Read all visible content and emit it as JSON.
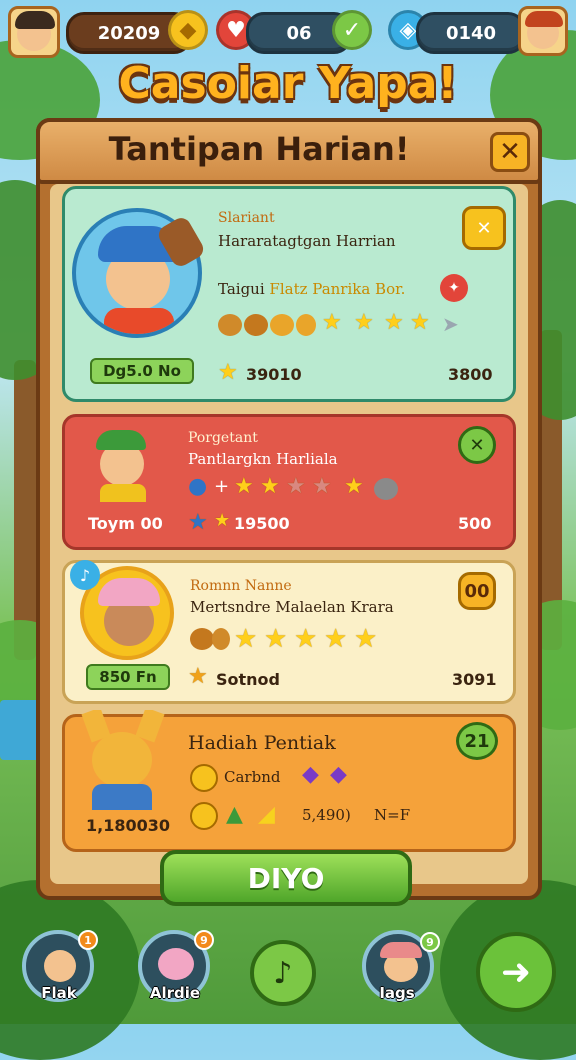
{
  "hud": {
    "coins_value": "20209",
    "hearts_value": "06",
    "gems_value": "0140"
  },
  "title": "Casoiar Yapa!",
  "panel": {
    "title": "Tantipan Harian!",
    "close_icon": "close-icon"
  },
  "cards": [
    {
      "heading": "Slariant",
      "line1": "Hararatagtgan Harrian",
      "line2_prefix": "Taigui",
      "line2_highlight": "Flatz Panrika Bor.",
      "tag": "Dg5.0 No",
      "amount_left": "39010",
      "amount_right": "3800",
      "badge_icon": "close-icon",
      "colors": {
        "bg": "#b9ead0",
        "border": "#2f8a6a"
      }
    },
    {
      "heading": "Porgetant",
      "line1": "Pantlargkn Harliala",
      "label_left": "Toym 00",
      "amount_left": "19500",
      "amount_right": "500",
      "badge_icon": "close-icon",
      "colors": {
        "bg": "#e2584a",
        "border": "#a5362a"
      }
    },
    {
      "heading": "Romnn Nanne",
      "line1": "Mertsndre Malaelan Krara",
      "tag": "850 Fn",
      "label_left": "Sotnod",
      "amount_right": "3091",
      "badge_text": "00",
      "colors": {
        "bg": "#fbf0c8",
        "border": "#c9a356"
      }
    },
    {
      "heading": "Hadiah Pentiak",
      "line1": "Carbnd",
      "line2": "5,490)",
      "line2b": "N=F",
      "amount_left": "1,180030",
      "badge_text": "21",
      "colors": {
        "bg": "#f5a23a",
        "border": "#b5641a"
      }
    }
  ],
  "main_button": "DIYO",
  "nav": [
    {
      "label": "Flak",
      "badge": "1"
    },
    {
      "label": "Alrdie",
      "badge": "9"
    },
    {
      "label": "",
      "icon": "music-note-icon"
    },
    {
      "label": "Iags",
      "badge": "9"
    },
    {
      "label": "",
      "icon": "arrow-forward-icon"
    }
  ]
}
